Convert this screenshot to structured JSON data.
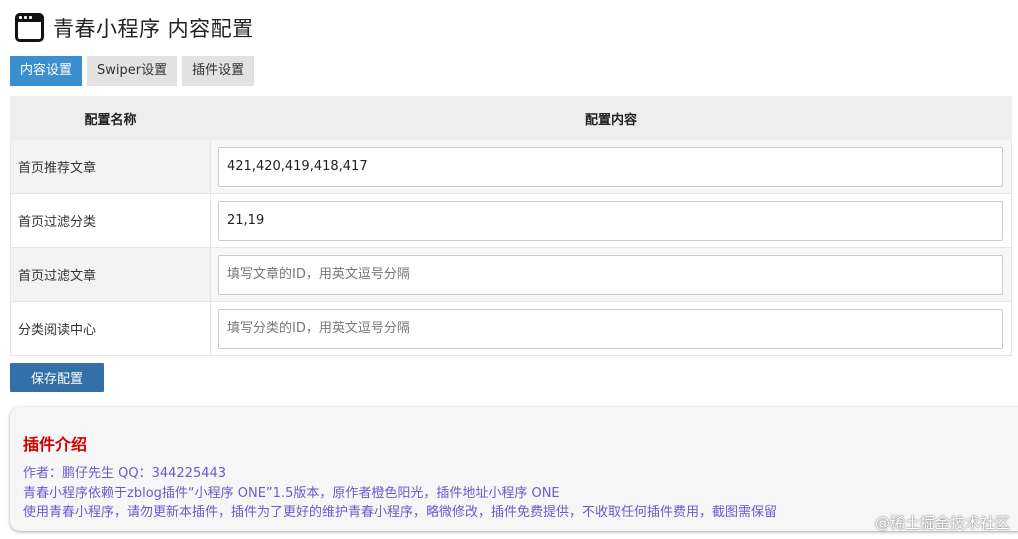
{
  "header": {
    "title": "青春小程序 内容配置"
  },
  "tabs": [
    {
      "label": "内容设置",
      "active": true
    },
    {
      "label": "Swiper设置",
      "active": false
    },
    {
      "label": "插件设置",
      "active": false
    }
  ],
  "table": {
    "headers": [
      "配置名称",
      "配置内容"
    ],
    "rows": [
      {
        "label": "首页推荐文章",
        "value": "421,420,419,418,417",
        "placeholder": ""
      },
      {
        "label": "首页过滤分类",
        "value": "21,19",
        "placeholder": ""
      },
      {
        "label": "首页过滤文章",
        "value": "",
        "placeholder": "填写文章的ID，用英文逗号分隔"
      },
      {
        "label": "分类阅读中心",
        "value": "",
        "placeholder": "填写分类的ID，用英文逗号分隔"
      }
    ]
  },
  "save_button": "保存配置",
  "intro": {
    "title": "插件介绍",
    "line1": "作者：鹏仔先生 QQ：344225443",
    "line2": "青春小程序依赖于zblog插件“小程序 ONE”1.5版本，原作者橙色阳光，插件地址小程序 ONE",
    "line3": "使用青春小程序，请勿更新本插件，插件为了更好的维护青春小程序，略微修改，插件免费提供，不收取任何插件费用，截图需保留"
  },
  "watermark": "@稀土掘金技术社区",
  "colors": {
    "tab_active": "#3a8fd0",
    "save_button": "#336fa8",
    "intro_title": "#d40000",
    "intro_text": "#6a5acd"
  }
}
